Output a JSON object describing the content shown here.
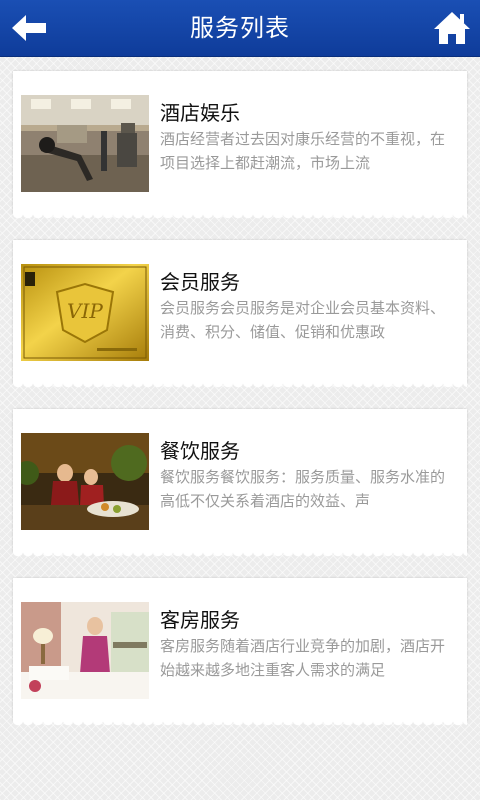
{
  "header": {
    "title": "服务列表",
    "back_icon": "arrow-left-icon",
    "home_icon": "home-icon",
    "bar_color": "#1546a8"
  },
  "services": [
    {
      "title": "酒店娱乐",
      "description": "酒店经营者过去因对康乐经营的不重视，在项目选择上都赶潮流，市场上流",
      "image": "gym-equipment-photo"
    },
    {
      "title": "会员服务",
      "description": "会员服务会员服务是对企业会员基本资料、消费、积分、储值、促销和优惠政",
      "image": "vip-gold-card-photo"
    },
    {
      "title": "餐饮服务",
      "description": "餐饮服务餐饮服务：服务质量、服务水准的高低不仅关系着酒店的效益、声",
      "image": "restaurant-waitress-photo"
    },
    {
      "title": "客房服务",
      "description": "客房服务随着酒店行业竞争的加剧，酒店开始越来越多地注重客人需求的满足",
      "image": "hotel-room-maid-photo"
    }
  ]
}
